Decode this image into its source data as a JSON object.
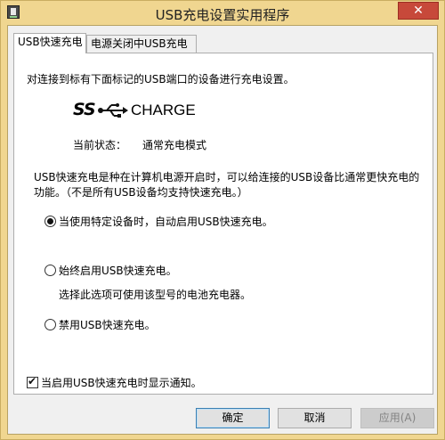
{
  "window": {
    "title": "USB充电设置实用程序",
    "close_label": "✕"
  },
  "tabs": [
    {
      "label": "USB快速充电",
      "active": true
    },
    {
      "label": "电源关闭中USB充电",
      "active": false
    }
  ],
  "panel": {
    "description": "对连接到标有下面标记的USB端口的设备进行充电设置。",
    "logo": {
      "ss_text": "SS",
      "word": "CHARGE"
    },
    "status_label": "当前状态：",
    "status_value": "通常充电模式",
    "info_text": "USB快速充电是种在计算机电源开启时，可以给连接的USB设备比通常更快充电的功能。（不是所有USB设备均支持快速充电。）",
    "options": [
      {
        "label": "当使用特定设备时，自动启用USB快速充电。",
        "selected": true
      },
      {
        "label": "始终启用USB快速充电。",
        "selected": false
      },
      {
        "label": "禁用USB快速充电。",
        "selected": false
      }
    ],
    "option_note": "选择此选项可使用该型号的电池充电器。",
    "notify_checkbox": {
      "label": "当启用USB快速充电时显示通知。",
      "checked": true
    }
  },
  "buttons": {
    "ok": "确定",
    "cancel": "取消",
    "apply": "应用(A)"
  }
}
